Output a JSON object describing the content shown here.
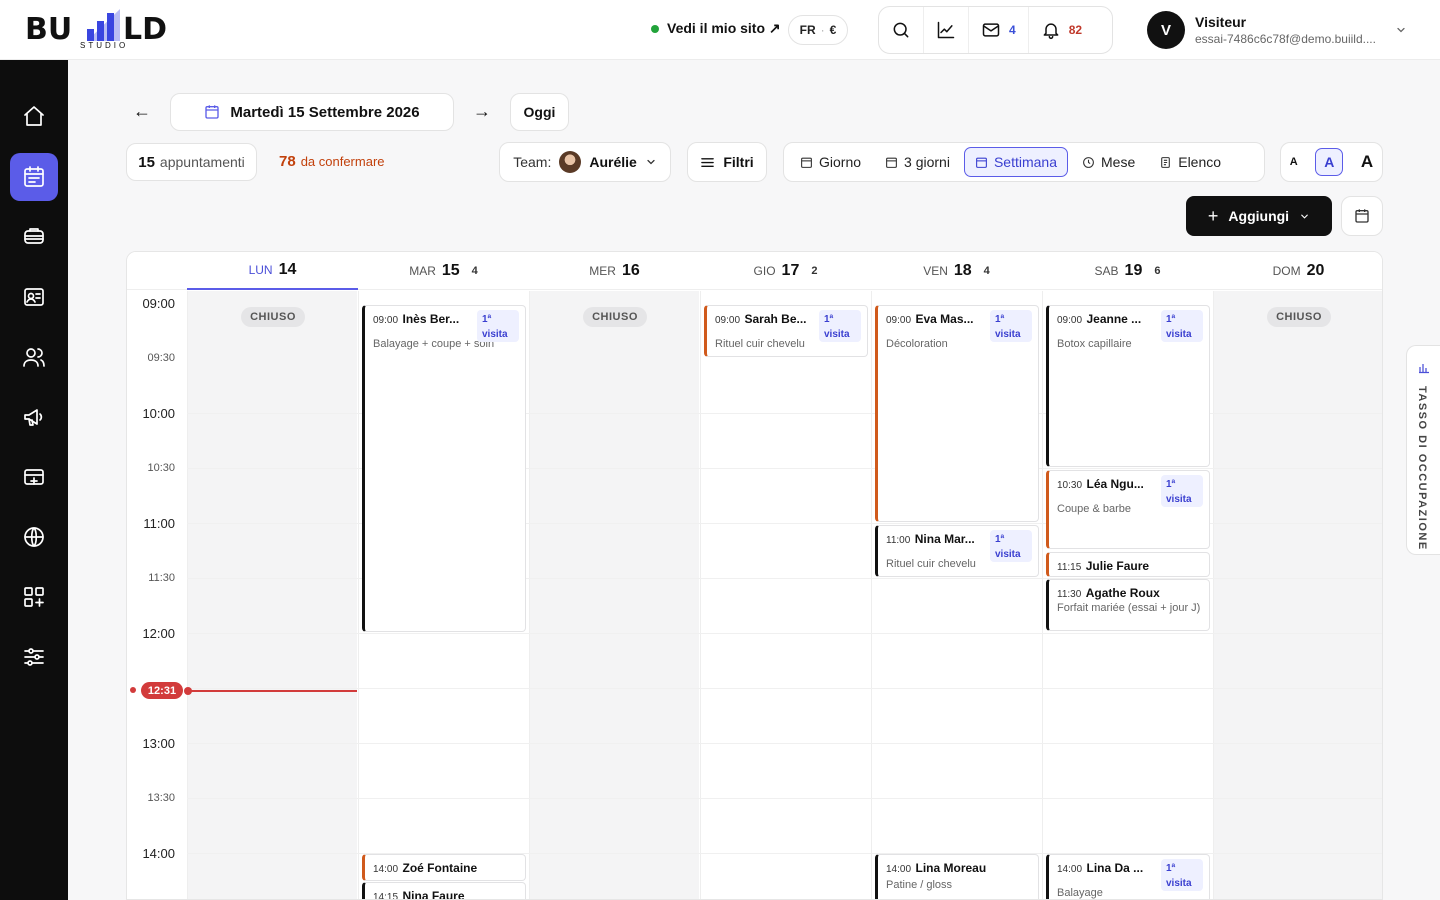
{
  "brand": {
    "name": "BU  LD",
    "sub": "STUDIO"
  },
  "topbar": {
    "site_link": "Vedi il mio sito ↗",
    "lang": "FR",
    "currency": "€",
    "mail_count": "4",
    "notif_count": "82",
    "user_initial": "V",
    "user_name": "Visiteur",
    "user_email": "essai-7486c6c78f@demo.buiild...."
  },
  "nav": {
    "prev": "←",
    "next": "→",
    "date_label": "Martedì 15 Settembre 2026",
    "today": "Oggi"
  },
  "stats": {
    "appointments_count": "15",
    "appointments_label": "appuntamenti",
    "to_confirm_count": "78",
    "to_confirm_label": "da confermare"
  },
  "team": {
    "label": "Team:",
    "member": "Aurélie"
  },
  "filters": {
    "label": "Filtri"
  },
  "views": [
    {
      "label": "Giorno",
      "active": false
    },
    {
      "label": "3 giorni",
      "active": false
    },
    {
      "label": "Settimana",
      "active": true
    },
    {
      "label": "Mese",
      "active": false
    },
    {
      "label": "Elenco",
      "active": false
    }
  ],
  "font_sizes": [
    "A",
    "A",
    "A"
  ],
  "add_button": "Aggiungi",
  "days": [
    {
      "dow": "LUN",
      "num": "14",
      "count": "",
      "closed": true,
      "active": true
    },
    {
      "dow": "MAR",
      "num": "15",
      "count": "4",
      "closed": false,
      "active": false
    },
    {
      "dow": "MER",
      "num": "16",
      "count": "",
      "closed": true,
      "active": false
    },
    {
      "dow": "GIO",
      "num": "17",
      "count": "2",
      "closed": false,
      "active": false
    },
    {
      "dow": "VEN",
      "num": "18",
      "count": "4",
      "closed": false,
      "active": false
    },
    {
      "dow": "SAB",
      "num": "19",
      "count": "6",
      "closed": false,
      "active": false
    },
    {
      "dow": "DOM",
      "num": "20",
      "count": "",
      "closed": true,
      "active": false
    }
  ],
  "closed_label": "CHIUSO",
  "hours": [
    "09:00",
    "09:30",
    "10:00",
    "10:30",
    "11:00",
    "11:30",
    "12:00",
    "12:30",
    "13:00",
    "13:30",
    "14:00"
  ],
  "now_label": "12:31",
  "first_visit_tag": "1ª visita",
  "appointments": [
    {
      "day": 1,
      "time": "09:00",
      "name": "Inès Ber...",
      "service": "Balayage + coupe + soin",
      "first_visit": true,
      "color": "black"
    },
    {
      "day": 1,
      "time": "14:00",
      "name": "Zoé Fontaine",
      "service": "",
      "first_visit": false,
      "color": "orange"
    },
    {
      "day": 1,
      "time": "14:15",
      "name": "Nina Faure",
      "service": "",
      "first_visit": false,
      "color": "black"
    },
    {
      "day": 3,
      "time": "09:00",
      "name": "Sarah Be...",
      "service": "Rituel cuir chevelu",
      "first_visit": true,
      "color": "orange"
    },
    {
      "day": 4,
      "time": "09:00",
      "name": "Eva Mas...",
      "service": "Décoloration",
      "first_visit": true,
      "color": "orange"
    },
    {
      "day": 4,
      "time": "11:00",
      "name": "Nina Mar...",
      "service": "Rituel cuir chevelu",
      "first_visit": true,
      "color": "black"
    },
    {
      "day": 4,
      "time": "14:00",
      "name": "Lina Moreau",
      "service": "Patine / gloss",
      "first_visit": false,
      "color": "black"
    },
    {
      "day": 5,
      "time": "09:00",
      "name": "Jeanne ...",
      "service": "Botox capillaire",
      "first_visit": true,
      "color": "black"
    },
    {
      "day": 5,
      "time": "10:30",
      "name": "Léa Ngu...",
      "service": "Coupe & barbe",
      "first_visit": true,
      "color": "orange"
    },
    {
      "day": 5,
      "time": "11:15",
      "name": "Julie Faure",
      "service": "",
      "first_visit": false,
      "color": "orange"
    },
    {
      "day": 5,
      "time": "11:30",
      "name": "Agathe Roux",
      "service": "Forfait mariée (essai + jour J)",
      "first_visit": false,
      "color": "black"
    },
    {
      "day": 5,
      "time": "14:00",
      "name": "Lina Da ...",
      "service": "Balayage",
      "first_visit": true,
      "color": "black"
    }
  ],
  "occupancy_tab": "TASSO DI OCCUPAZIONE"
}
